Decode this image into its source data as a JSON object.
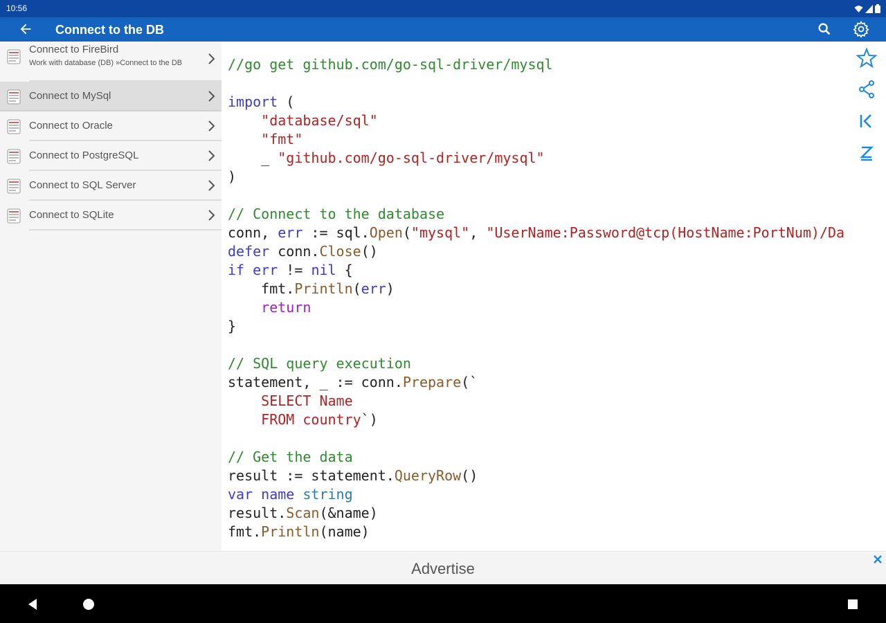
{
  "status": {
    "time": "10:56"
  },
  "appbar": {
    "title": "Connect to the DB"
  },
  "sidebar": {
    "items": [
      {
        "label": "Connect to FireBird",
        "sub": "Work with database (DB) »Connect to the DB"
      },
      {
        "label": "Connect to MySql"
      },
      {
        "label": "Connect to Oracle"
      },
      {
        "label": "Connect to PostgreSQL"
      },
      {
        "label": "Connect to SQL Server"
      },
      {
        "label": "Connect to SQLite"
      }
    ]
  },
  "code": {
    "lines": [
      "//go get github.com/go-sql-driver/mysql",
      "",
      "import (",
      "    \"database/sql\"",
      "    \"fmt\"",
      "    _ \"github.com/go-sql-driver/mysql\"",
      ")",
      "",
      "// Connect to the database",
      "conn, err := sql.Open(\"mysql\", \"UserName:Password@tcp(HostName:PortNum)/Da",
      "defer conn.Close()",
      "if err != nil {",
      "    fmt.Println(err)",
      "    return",
      "}",
      "",
      "// SQL query execution",
      "statement, _ := conn.Prepare(`",
      "    SELECT Name",
      "    FROM country`)",
      "",
      "// Get the data",
      "result := statement.QueryRow()",
      "var name string",
      "result.Scan(&name)",
      "fmt.Println(name)"
    ]
  },
  "actions": {
    "icons": [
      "star-icon",
      "share-icon",
      "first-page-icon",
      "font-size-icon"
    ]
  },
  "ad": {
    "label": "Advertise"
  },
  "colors": {
    "status_bar": "#0d47a1",
    "app_bar": "#1565c0",
    "accent": "#1e88e5",
    "comment": "#2e8b2e",
    "keyword": "#3b3bd0",
    "string": "#b22222"
  }
}
